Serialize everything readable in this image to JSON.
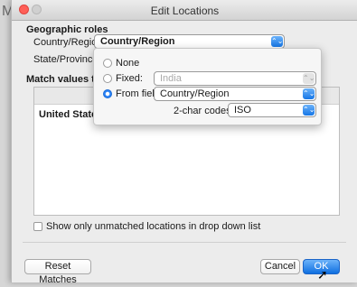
{
  "background": {
    "app_letter": "M"
  },
  "window": {
    "title": "Edit Locations"
  },
  "geo": {
    "section_title": "Geographic roles",
    "country_label": "Country/Region:",
    "country_value": "Country/Region",
    "state_label": "State/Province:"
  },
  "match": {
    "title_visible": "Match values to loca",
    "rows": [
      "United States"
    ]
  },
  "popover": {
    "none_label": "None",
    "fixed_label": "Fixed:",
    "fixed_value": "India",
    "from_field_label": "From field:",
    "from_field_value": "Country/Region",
    "codes_label": "2-char codes:",
    "codes_value": "ISO"
  },
  "options": {
    "show_unmatched_label": "Show only unmatched locations in drop down list"
  },
  "buttons": {
    "reset": "Reset Matches",
    "cancel": "Cancel",
    "ok": "OK"
  },
  "icons": {
    "dropdown": "⌃⌄"
  }
}
